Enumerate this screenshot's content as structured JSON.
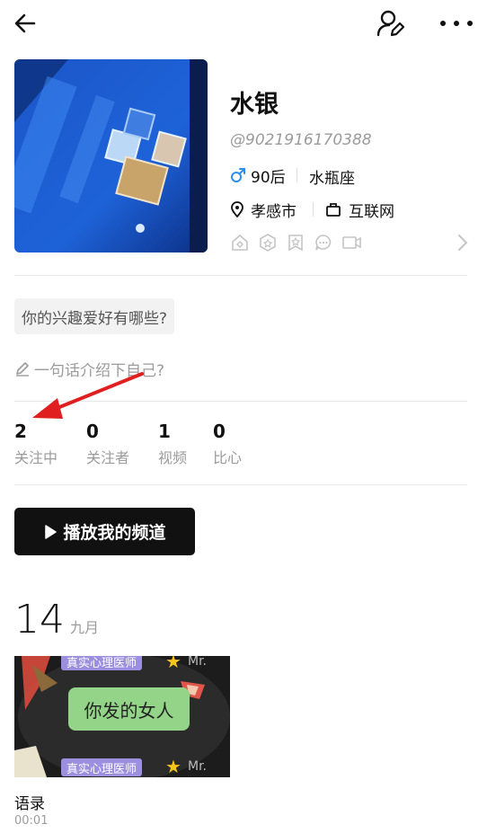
{
  "header": {
    "back_icon": "arrow-left-icon",
    "edit_profile_icon": "user-edit-icon",
    "more_icon": "more-horizontal-icon"
  },
  "profile": {
    "name": "水银",
    "user_id": "@9021916170388",
    "gender_icon": "male-icon",
    "age_group": "90后",
    "zodiac": "水瓶座",
    "location": "孝感市",
    "industry": "互联网",
    "colors": {
      "male_icon": "#2d8cf0"
    }
  },
  "hobby_prompt": "你的兴趣爱好有哪些?",
  "bio_placeholder": "一句话介绍下自己?",
  "stats": [
    {
      "value": "2",
      "label": "关注中"
    },
    {
      "value": "0",
      "label": "关注者"
    },
    {
      "value": "1",
      "label": "视频"
    },
    {
      "value": "0",
      "label": "比心"
    }
  ],
  "play_channel_button": "播放我的频道",
  "date": {
    "day": "14",
    "month": "九月"
  },
  "video": {
    "overlay_tag": "真实心理医师",
    "overlay_tag_partial": "Mr.",
    "bubble_text": "你发的女人",
    "title": "语录",
    "duration": "00:01"
  },
  "colors": {
    "annotation_arrow": "#e02020",
    "button_bg": "#111111"
  }
}
